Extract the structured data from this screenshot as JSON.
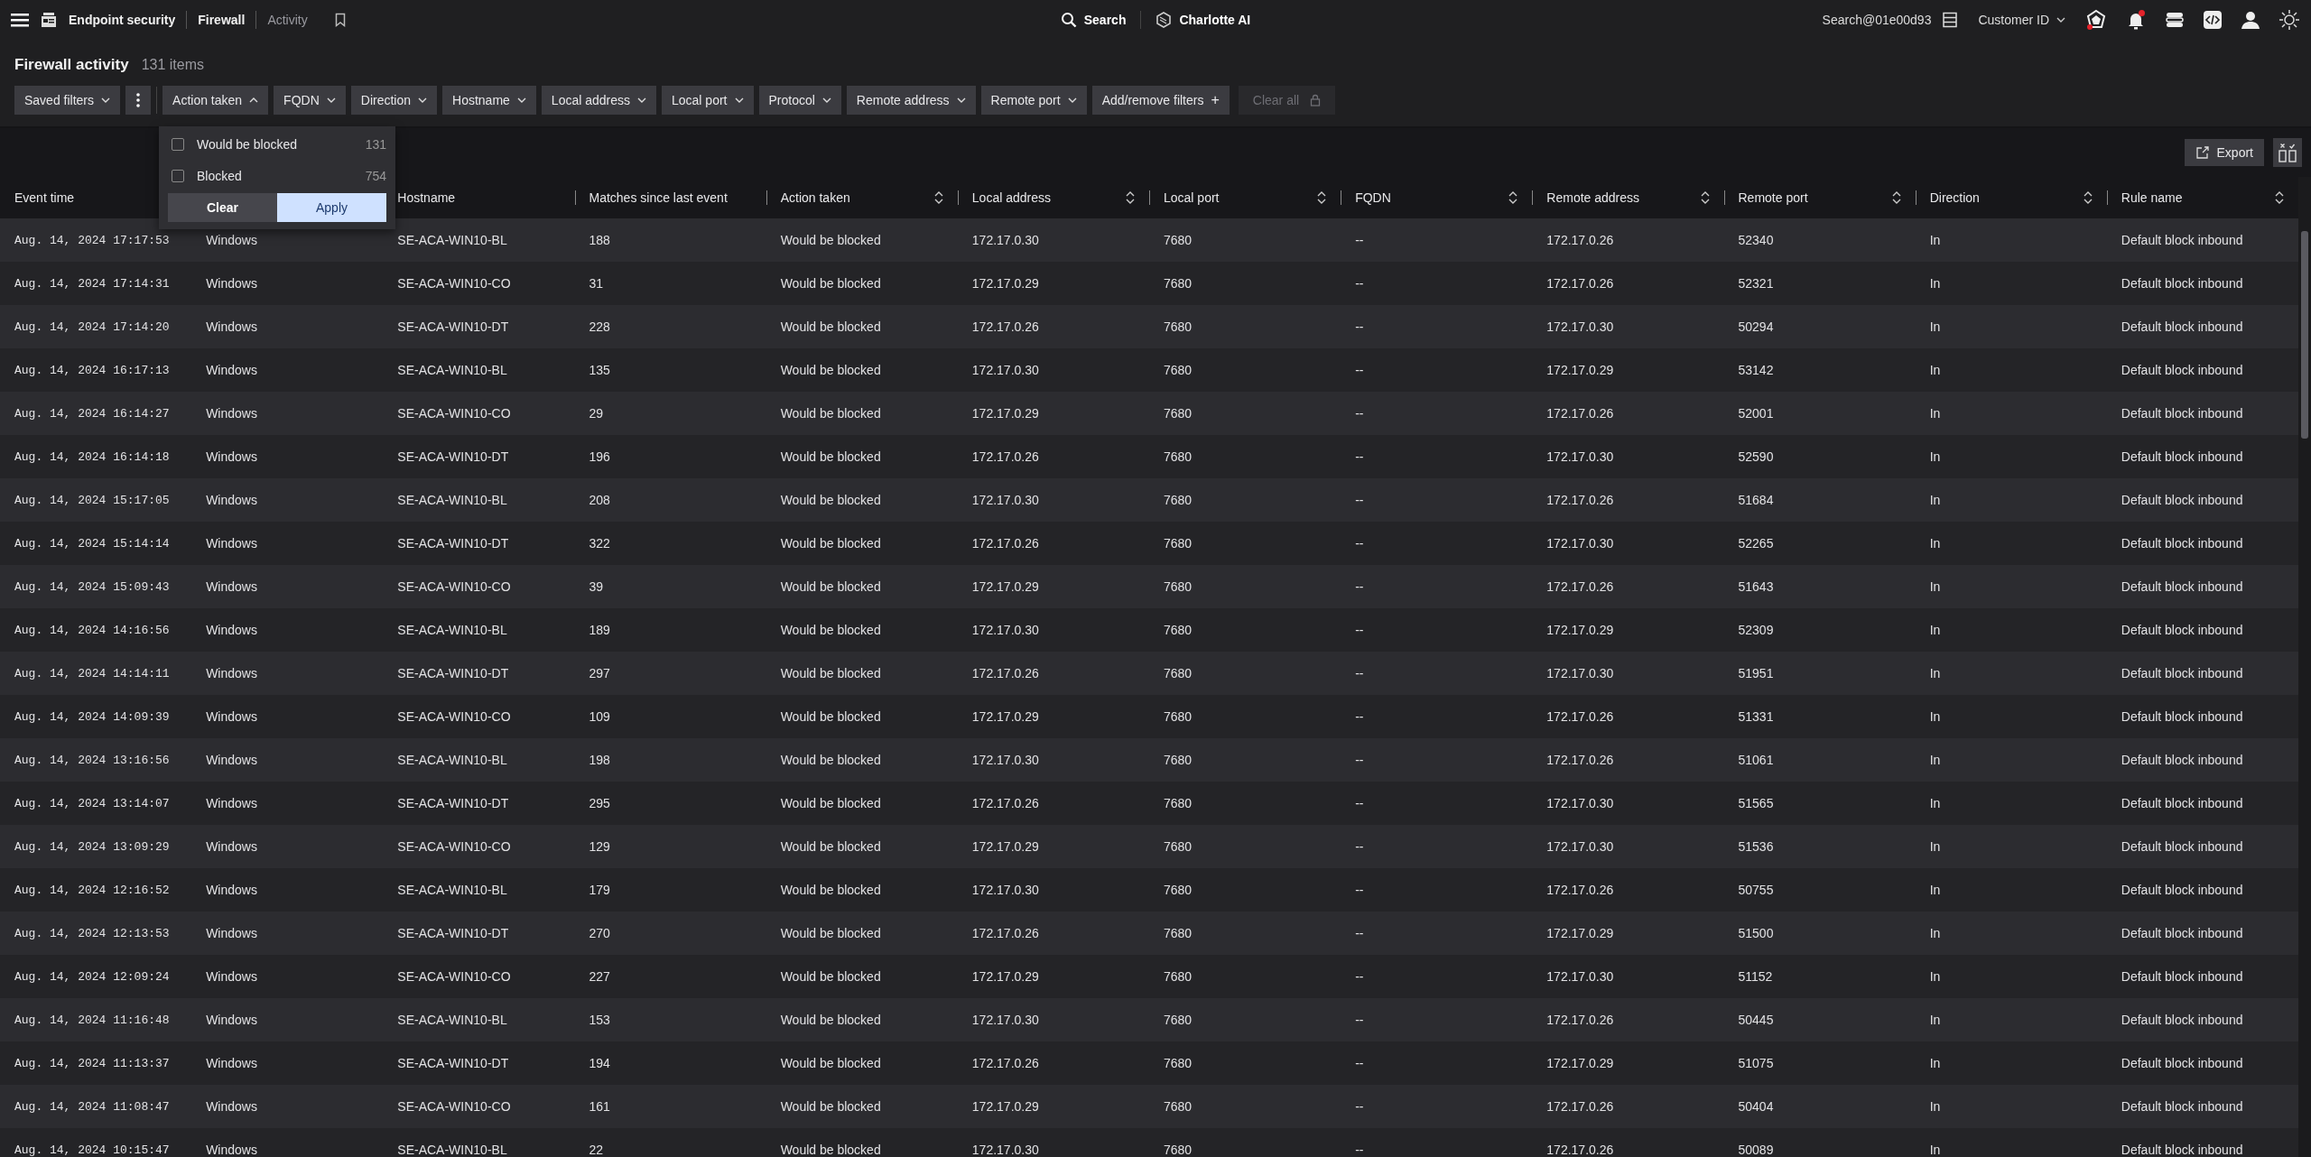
{
  "nav": {
    "breadcrumbs": [
      {
        "label": "Endpoint security",
        "current": false
      },
      {
        "label": "Firewall",
        "current": false
      },
      {
        "label": "Activity",
        "current": true
      }
    ],
    "search": "Search",
    "assistant": "Charlotte AI",
    "account": "Search@01e00d93",
    "customer": "Customer ID"
  },
  "header": {
    "title": "Firewall activity",
    "count": "131 items"
  },
  "filters": [
    {
      "label": "Saved filters",
      "expanded": false
    },
    {
      "label": "Action taken",
      "expanded": true
    },
    {
      "label": "FQDN",
      "expanded": false
    },
    {
      "label": "Direction",
      "expanded": false
    },
    {
      "label": "Hostname",
      "expanded": false
    },
    {
      "label": "Local address",
      "expanded": false
    },
    {
      "label": "Local port",
      "expanded": false
    },
    {
      "label": "Protocol",
      "expanded": false
    },
    {
      "label": "Remote address",
      "expanded": false
    },
    {
      "label": "Remote port",
      "expanded": false
    }
  ],
  "add_filters": "Add/remove filters",
  "add_icon": "+",
  "clear_all": {
    "label": "Clear all",
    "disabled": true
  },
  "dropdown": {
    "options": [
      {
        "label": "Would be blocked",
        "count": "131",
        "checked": false
      },
      {
        "label": "Blocked",
        "count": "754",
        "checked": false
      }
    ],
    "clear": "Clear",
    "apply": "Apply"
  },
  "export": "Export",
  "table": {
    "columns": [
      {
        "label": "Event time",
        "sortable": false
      },
      {},
      {
        "label": "Hostname",
        "sortable": false
      },
      {
        "label": "Matches since last event",
        "sortable": false
      },
      {
        "label": "Action taken",
        "sortable": true
      },
      {
        "label": "Local address",
        "sortable": true
      },
      {
        "label": "Local port",
        "sortable": true
      },
      {
        "label": "FQDN",
        "sortable": true
      },
      {
        "label": "Remote address",
        "sortable": true
      },
      {
        "label": "Remote port",
        "sortable": true
      },
      {
        "label": "Direction",
        "sortable": true
      },
      {
        "label": "Rule name",
        "sortable": true
      }
    ],
    "rows": [
      [
        "Aug. 14, 2024 17:17:53",
        "Windows",
        "SE-ACA-WIN10-BL",
        "188",
        "Would be blocked",
        "172.17.0.30",
        "7680",
        "--",
        "172.17.0.26",
        "52340",
        "In",
        "Default block inbound"
      ],
      [
        "Aug. 14, 2024 17:14:31",
        "Windows",
        "SE-ACA-WIN10-CO",
        "31",
        "Would be blocked",
        "172.17.0.29",
        "7680",
        "--",
        "172.17.0.26",
        "52321",
        "In",
        "Default block inbound"
      ],
      [
        "Aug. 14, 2024 17:14:20",
        "Windows",
        "SE-ACA-WIN10-DT",
        "228",
        "Would be blocked",
        "172.17.0.26",
        "7680",
        "--",
        "172.17.0.30",
        "50294",
        "In",
        "Default block inbound"
      ],
      [
        "Aug. 14, 2024 16:17:13",
        "Windows",
        "SE-ACA-WIN10-BL",
        "135",
        "Would be blocked",
        "172.17.0.30",
        "7680",
        "--",
        "172.17.0.29",
        "53142",
        "In",
        "Default block inbound"
      ],
      [
        "Aug. 14, 2024 16:14:27",
        "Windows",
        "SE-ACA-WIN10-CO",
        "29",
        "Would be blocked",
        "172.17.0.29",
        "7680",
        "--",
        "172.17.0.26",
        "52001",
        "In",
        "Default block inbound"
      ],
      [
        "Aug. 14, 2024 16:14:18",
        "Windows",
        "SE-ACA-WIN10-DT",
        "196",
        "Would be blocked",
        "172.17.0.26",
        "7680",
        "--",
        "172.17.0.30",
        "52590",
        "In",
        "Default block inbound"
      ],
      [
        "Aug. 14, 2024 15:17:05",
        "Windows",
        "SE-ACA-WIN10-BL",
        "208",
        "Would be blocked",
        "172.17.0.30",
        "7680",
        "--",
        "172.17.0.26",
        "51684",
        "In",
        "Default block inbound"
      ],
      [
        "Aug. 14, 2024 15:14:14",
        "Windows",
        "SE-ACA-WIN10-DT",
        "322",
        "Would be blocked",
        "172.17.0.26",
        "7680",
        "--",
        "172.17.0.30",
        "52265",
        "In",
        "Default block inbound"
      ],
      [
        "Aug. 14, 2024 15:09:43",
        "Windows",
        "SE-ACA-WIN10-CO",
        "39",
        "Would be blocked",
        "172.17.0.29",
        "7680",
        "--",
        "172.17.0.26",
        "51643",
        "In",
        "Default block inbound"
      ],
      [
        "Aug. 14, 2024 14:16:56",
        "Windows",
        "SE-ACA-WIN10-BL",
        "189",
        "Would be blocked",
        "172.17.0.30",
        "7680",
        "--",
        "172.17.0.29",
        "52309",
        "In",
        "Default block inbound"
      ],
      [
        "Aug. 14, 2024 14:14:11",
        "Windows",
        "SE-ACA-WIN10-DT",
        "297",
        "Would be blocked",
        "172.17.0.26",
        "7680",
        "--",
        "172.17.0.30",
        "51951",
        "In",
        "Default block inbound"
      ],
      [
        "Aug. 14, 2024 14:09:39",
        "Windows",
        "SE-ACA-WIN10-CO",
        "109",
        "Would be blocked",
        "172.17.0.29",
        "7680",
        "--",
        "172.17.0.26",
        "51331",
        "In",
        "Default block inbound"
      ],
      [
        "Aug. 14, 2024 13:16:56",
        "Windows",
        "SE-ACA-WIN10-BL",
        "198",
        "Would be blocked",
        "172.17.0.30",
        "7680",
        "--",
        "172.17.0.26",
        "51061",
        "In",
        "Default block inbound"
      ],
      [
        "Aug. 14, 2024 13:14:07",
        "Windows",
        "SE-ACA-WIN10-DT",
        "295",
        "Would be blocked",
        "172.17.0.26",
        "7680",
        "--",
        "172.17.0.30",
        "51565",
        "In",
        "Default block inbound"
      ],
      [
        "Aug. 14, 2024 13:09:29",
        "Windows",
        "SE-ACA-WIN10-CO",
        "129",
        "Would be blocked",
        "172.17.0.29",
        "7680",
        "--",
        "172.17.0.30",
        "51536",
        "In",
        "Default block inbound"
      ],
      [
        "Aug. 14, 2024 12:16:52",
        "Windows",
        "SE-ACA-WIN10-BL",
        "179",
        "Would be blocked",
        "172.17.0.30",
        "7680",
        "--",
        "172.17.0.26",
        "50755",
        "In",
        "Default block inbound"
      ],
      [
        "Aug. 14, 2024 12:13:53",
        "Windows",
        "SE-ACA-WIN10-DT",
        "270",
        "Would be blocked",
        "172.17.0.26",
        "7680",
        "--",
        "172.17.0.29",
        "51500",
        "In",
        "Default block inbound"
      ],
      [
        "Aug. 14, 2024 12:09:24",
        "Windows",
        "SE-ACA-WIN10-CO",
        "227",
        "Would be blocked",
        "172.17.0.29",
        "7680",
        "--",
        "172.17.0.30",
        "51152",
        "In",
        "Default block inbound"
      ],
      [
        "Aug. 14, 2024 11:16:48",
        "Windows",
        "SE-ACA-WIN10-BL",
        "153",
        "Would be blocked",
        "172.17.0.30",
        "7680",
        "--",
        "172.17.0.26",
        "50445",
        "In",
        "Default block inbound"
      ],
      [
        "Aug. 14, 2024 11:13:37",
        "Windows",
        "SE-ACA-WIN10-DT",
        "194",
        "Would be blocked",
        "172.17.0.26",
        "7680",
        "--",
        "172.17.0.29",
        "51075",
        "In",
        "Default block inbound"
      ],
      [
        "Aug. 14, 2024 11:08:47",
        "Windows",
        "SE-ACA-WIN10-CO",
        "161",
        "Would be blocked",
        "172.17.0.29",
        "7680",
        "--",
        "172.17.0.26",
        "50404",
        "In",
        "Default block inbound"
      ],
      [
        "Aug. 14, 2024 10:15:47",
        "Windows",
        "SE-ACA-WIN10-BL",
        "22",
        "Would be blocked",
        "172.17.0.30",
        "7680",
        "--",
        "172.17.0.26",
        "50089",
        "In",
        "Default block inbound"
      ]
    ]
  }
}
